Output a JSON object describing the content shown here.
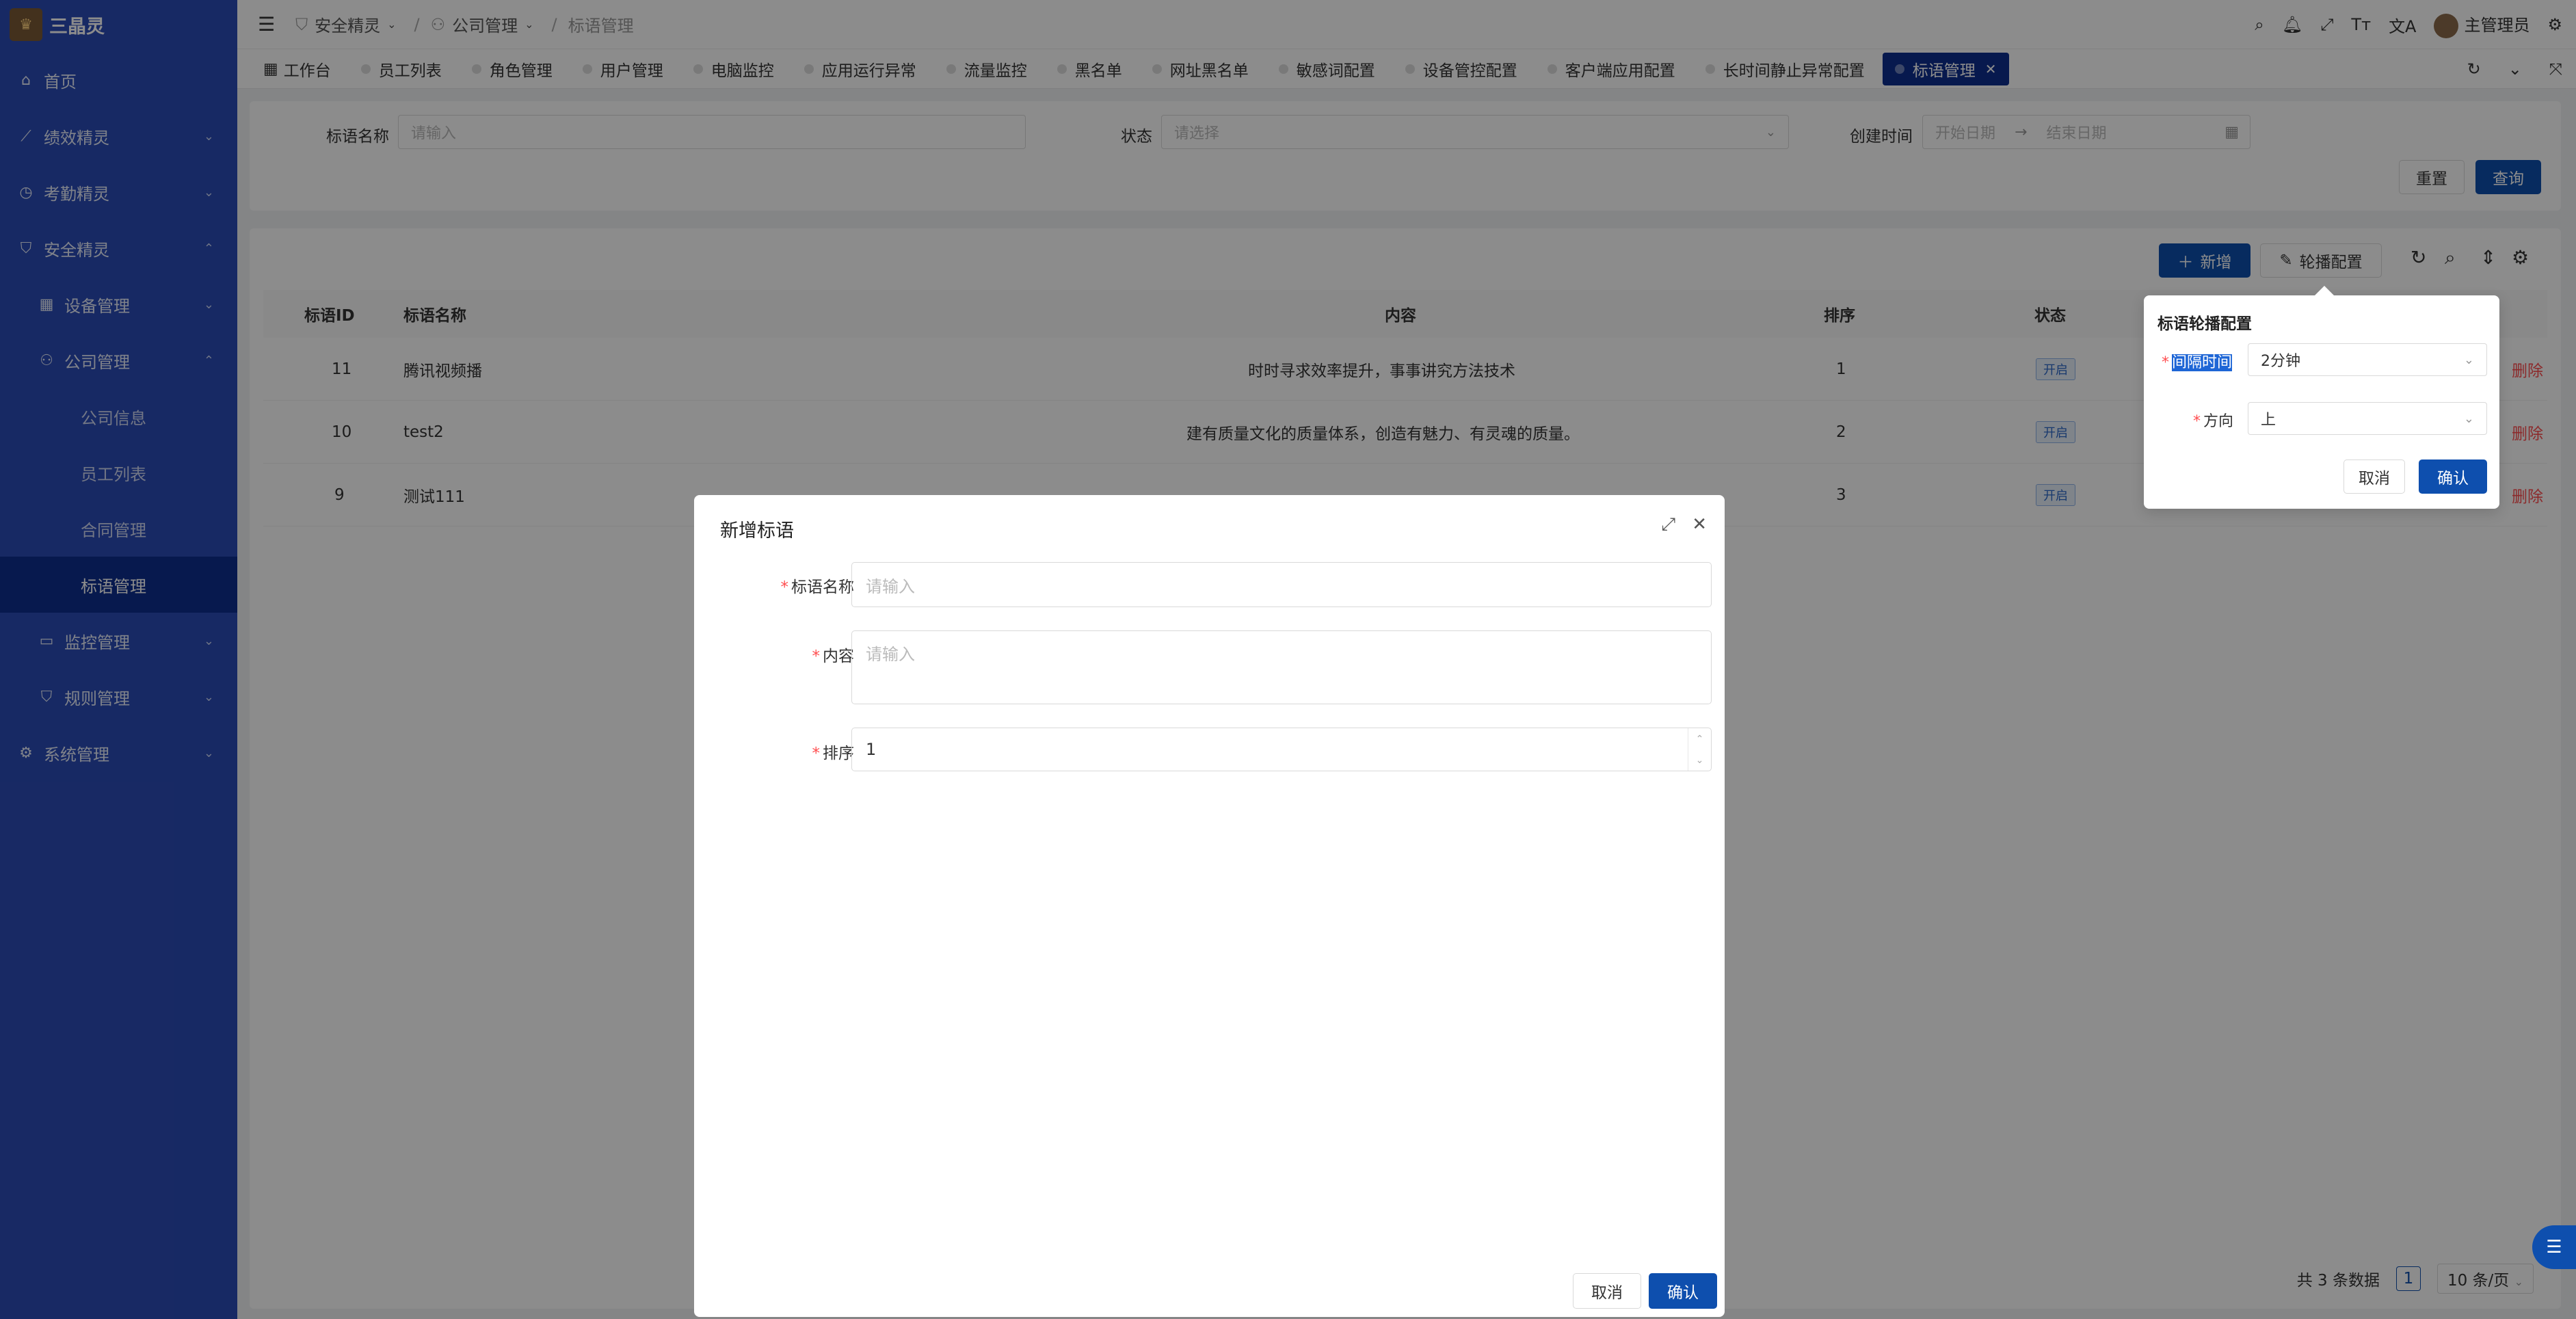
{
  "app": {
    "name": "三晶灵"
  },
  "sidebar": {
    "items": [
      {
        "label": "首页",
        "icon": "home-icon"
      },
      {
        "label": "绩效精灵",
        "icon": "chart-icon"
      },
      {
        "label": "考勤精灵",
        "icon": "clock-icon"
      },
      {
        "label": "安全精灵",
        "icon": "shield-icon"
      },
      {
        "label": "设备管理",
        "icon": "grid-icon"
      },
      {
        "label": "公司管理",
        "icon": "user-icon"
      },
      {
        "label": "公司信息"
      },
      {
        "label": "员工列表"
      },
      {
        "label": "合同管理"
      },
      {
        "label": "标语管理"
      },
      {
        "label": "监控管理",
        "icon": "monitor-icon"
      },
      {
        "label": "规则管理",
        "icon": "shield-check-icon"
      },
      {
        "label": "系统管理",
        "icon": "gear-icon"
      }
    ]
  },
  "header": {
    "breadcrumb": [
      "安全精灵",
      "公司管理",
      "标语管理"
    ],
    "user": "主管理员"
  },
  "tabs": [
    "工作台",
    "员工列表",
    "角色管理",
    "用户管理",
    "电脑监控",
    "应用运行异常",
    "流量监控",
    "黑名单",
    "网址黑名单",
    "敏感词配置",
    "设备管控配置",
    "客户端应用配置",
    "长时间静止异常配置",
    "标语管理"
  ],
  "filter": {
    "name_label": "标语名称",
    "name_placeholder": "请输入",
    "status_label": "状态",
    "status_placeholder": "请选择",
    "created_label": "创建时间",
    "start_placeholder": "开始日期",
    "end_placeholder": "结束日期",
    "arrow": "→",
    "reset": "重置",
    "query": "查询"
  },
  "toolbar": {
    "add": "新增",
    "carousel": "轮播配置"
  },
  "table": {
    "columns": [
      "标语ID",
      "标语名称",
      "内容",
      "排序",
      "状态"
    ],
    "rows": [
      {
        "id": "11",
        "name": "腾讯视频播",
        "content": "时时寻求效率提升，事事讲究方法技术",
        "sort": "1",
        "status": "开启",
        "action": "删除"
      },
      {
        "id": "10",
        "name": "test2",
        "content": "建有质量文化的质量体系，创造有魅力、有灵魂的质量。",
        "sort": "2",
        "status": "开启",
        "action": "删除"
      },
      {
        "id": "9",
        "name": "测试111",
        "content": "",
        "sort": "3",
        "status": "开启",
        "action": "删除"
      }
    ]
  },
  "pager": {
    "total": "共 3 条数据",
    "page": "1",
    "size": "10 条/页"
  },
  "popover": {
    "title": "标语轮播配置",
    "interval_label": "间隔时间",
    "interval_value": "2分钟",
    "direction_label": "方向",
    "direction_value": "上",
    "cancel": "取消",
    "confirm": "确认"
  },
  "modal": {
    "title": "新增标语",
    "name_label": "标语名称",
    "name_placeholder": "请输入",
    "content_label": "内容",
    "content_placeholder": "请输入",
    "sort_label": "排序",
    "sort_value": "1",
    "cancel": "取消",
    "confirm": "确认"
  }
}
